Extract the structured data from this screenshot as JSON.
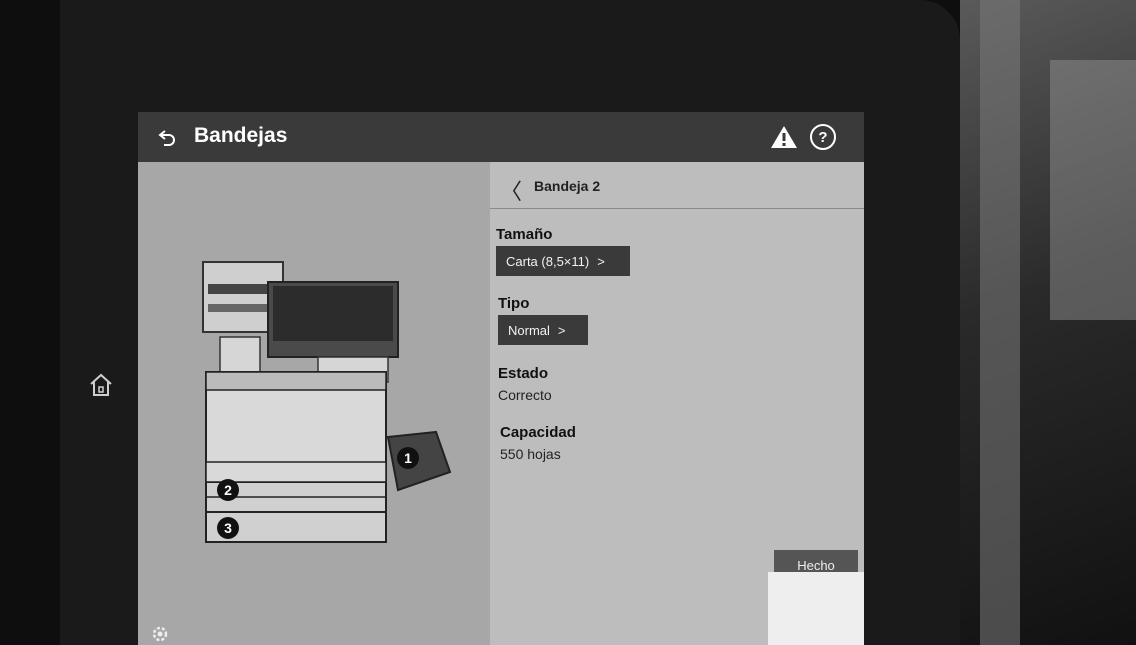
{
  "header": {
    "title": "Bandejas",
    "back_icon": "back-arrow-icon",
    "warning_icon": "warning-icon",
    "help_icon": "help-icon",
    "help_glyph": "?"
  },
  "side": {
    "home_icon": "home-icon"
  },
  "printer": {
    "tray_badges": [
      "1",
      "2",
      "3"
    ]
  },
  "detail": {
    "tray_title": "Bandeja 2",
    "back_glyph": "〈",
    "size": {
      "label": "Tamaño",
      "value": "Carta (8,5×11)"
    },
    "type": {
      "label": "Tipo",
      "value": "Normal"
    },
    "status": {
      "label": "Estado",
      "value": "Correcto"
    },
    "capacity": {
      "label": "Capacidad",
      "value": "550 hojas"
    }
  },
  "chevron_glyph": ">",
  "footer": {
    "done_label": "Hecho"
  },
  "colors": {
    "header_bg": "#3a3a3a",
    "pill_bg": "#3a3a3a",
    "screen_bg": "#a7a7a7"
  }
}
